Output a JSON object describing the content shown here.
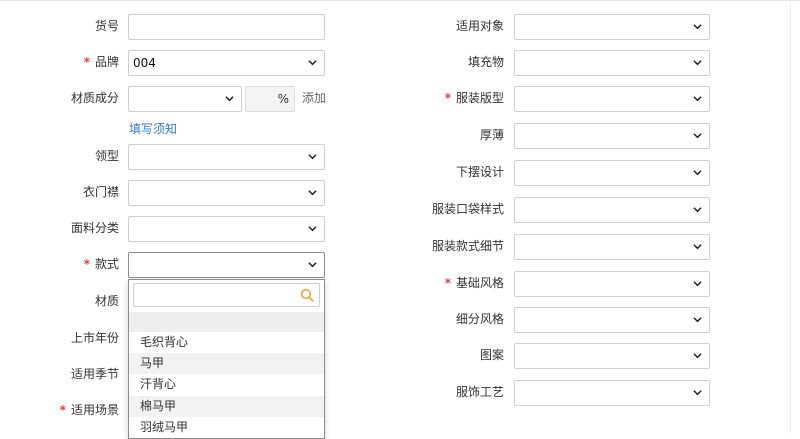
{
  "left": {
    "huohao": {
      "label": "货号",
      "value": ""
    },
    "pinpai": {
      "label": "品牌",
      "value": "004",
      "required": "*"
    },
    "caizhi_chengfen": {
      "label": "材质成分",
      "percent": "%",
      "add": "添加",
      "hint": "填写须知"
    },
    "lingxing": {
      "label": "领型"
    },
    "yimenjin": {
      "label": "衣门襟"
    },
    "mianliao": {
      "label": "面料分类"
    },
    "kuanshi": {
      "label": "款式",
      "required": "*"
    },
    "caizhi": {
      "label": "材质"
    },
    "shangshi": {
      "label": "上市年份"
    },
    "jijie": {
      "label": "适用季节"
    },
    "changjing": {
      "label": "适用场景",
      "required": "*"
    }
  },
  "right": {
    "duixiang": {
      "label": "适用对象"
    },
    "tianchong": {
      "label": "填充物"
    },
    "banxing": {
      "label": "服装版型",
      "required": "*"
    },
    "houbao": {
      "label": "厚薄"
    },
    "xiabai": {
      "label": "下摆设计"
    },
    "koudai": {
      "label": "服装口袋样式"
    },
    "xijie": {
      "label": "服装款式细节"
    },
    "jichu": {
      "label": "基础风格",
      "required": "*"
    },
    "xifen": {
      "label": "细分风格"
    },
    "tuan": {
      "label": "图案"
    },
    "gongyi": {
      "label": "服饰工艺"
    }
  },
  "dropdown": {
    "search_value": "",
    "options": [
      "毛织背心",
      "马甲",
      "汗背心",
      "棉马甲",
      "羽绒马甲"
    ]
  },
  "icons": {
    "chevron": "chevron-down-icon",
    "search": "search-icon"
  },
  "colors": {
    "required": "#e4393c",
    "link": "#2f7dd1",
    "search_icon": "#f0a030"
  }
}
